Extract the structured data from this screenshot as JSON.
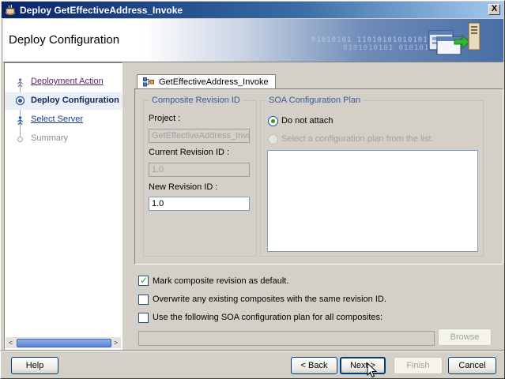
{
  "window": {
    "title": "Deploy GetEffectiveAddress_Invoke",
    "close_label": "X"
  },
  "banner": {
    "title": "Deploy Configuration",
    "binary_1": "01010101  11010101010101",
    "binary_2": "0101010101  01010101"
  },
  "steps": [
    {
      "label": "Deployment Action",
      "state": "visited"
    },
    {
      "label": "Deploy Configuration",
      "state": "current"
    },
    {
      "label": "Select Server",
      "state": "link"
    },
    {
      "label": "Summary",
      "state": "disabled"
    }
  ],
  "tab": {
    "label": "GetEffectiveAddress_Invoke"
  },
  "composite_revision": {
    "title": "Composite Revision ID",
    "project_label": "Project :",
    "project_value": "GetEffectiveAddress_Invoke",
    "current_label": "Current Revision ID :",
    "current_value": "1.0",
    "new_label": "New Revision ID :",
    "new_value": "1.0"
  },
  "soa_plan": {
    "title": "SOA Configuration Plan",
    "option_not_attach": "Do not attach",
    "option_select": "Select a configuration plan from the list.",
    "selected": "Do not attach"
  },
  "options": {
    "mark_default": {
      "label": "Mark composite revision as default.",
      "checked": true
    },
    "overwrite": {
      "label": "Overwrite any existing composites with the same revision ID.",
      "checked": false
    },
    "use_plan": {
      "label": "Use the following SOA configuration plan for all composites:",
      "checked": false
    },
    "plan_path": "",
    "browse_label": "Browse"
  },
  "buttons": {
    "help": "Help",
    "back": "< Back",
    "next": "Next >",
    "finish": "Finish",
    "cancel": "Cancel"
  },
  "colors": {
    "title_bar": "#0a246a",
    "accent_green": "#21a121",
    "group_title": "#3b5998"
  }
}
